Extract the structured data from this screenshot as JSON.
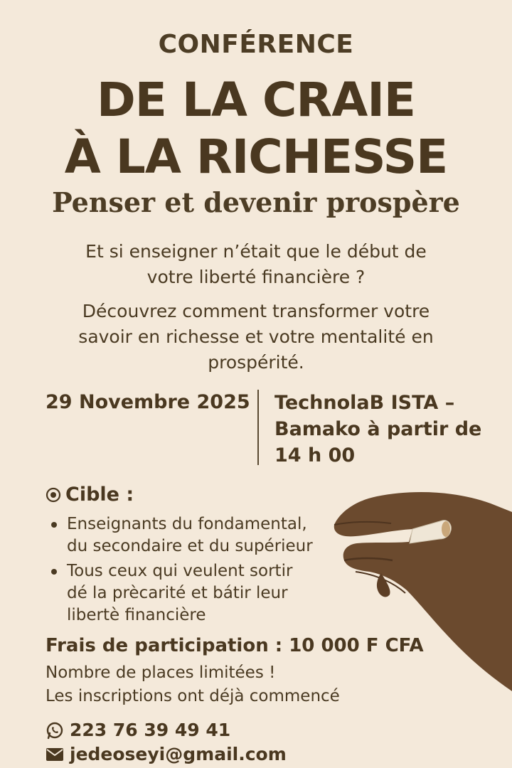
{
  "header": {
    "eyebrow": "CONFÉRENCE",
    "title_line1": "DE LA CRAIE",
    "title_line2": "À LA RICHESSE",
    "subtitle": "Penser et devenir prospère"
  },
  "intro": {
    "question_line1": "Et si enseigner n’était que le début de",
    "question_line2": "votre liberté financière ?",
    "desc_line1": "Découvrez comment transformer votre",
    "desc_line2": "savoir en richesse et votre mentalité en",
    "desc_line3": "prospérité."
  },
  "event": {
    "date": "29 Novembre 2025",
    "venue_line1": "TechnolaB ISTA –",
    "venue_line2": "Bamako à partir de",
    "venue_line3": "14 h 00"
  },
  "target": {
    "icon": "target-icon",
    "heading": "Cible :",
    "items": [
      {
        "line1": "Enseignants du fondamental,",
        "line2": "du secondaire et du supérieur"
      },
      {
        "line1": "Tous ceux qui veulent sortir",
        "line2": "dé la prècarité et bátir leur",
        "line3": "libertè financière"
      }
    ]
  },
  "fees": {
    "text": "Frais de participation : 10 000 F CFA",
    "note_line1": "Nombre de places limitées !",
    "note_line2": "Les inscriptions ont déjà commencé"
  },
  "contact": {
    "phone_icon": "whatsapp-icon",
    "phone": "223 76 39 49 41",
    "email_icon": "envelope-icon",
    "email": "jedeoseyi@gmail.com"
  },
  "illustration": {
    "name": "hand-holding-chalk"
  },
  "colors": {
    "background": "#f4e9da",
    "text": "#4a3a22",
    "skin": "#6b4a2e",
    "chalk": "#efe6d6"
  }
}
